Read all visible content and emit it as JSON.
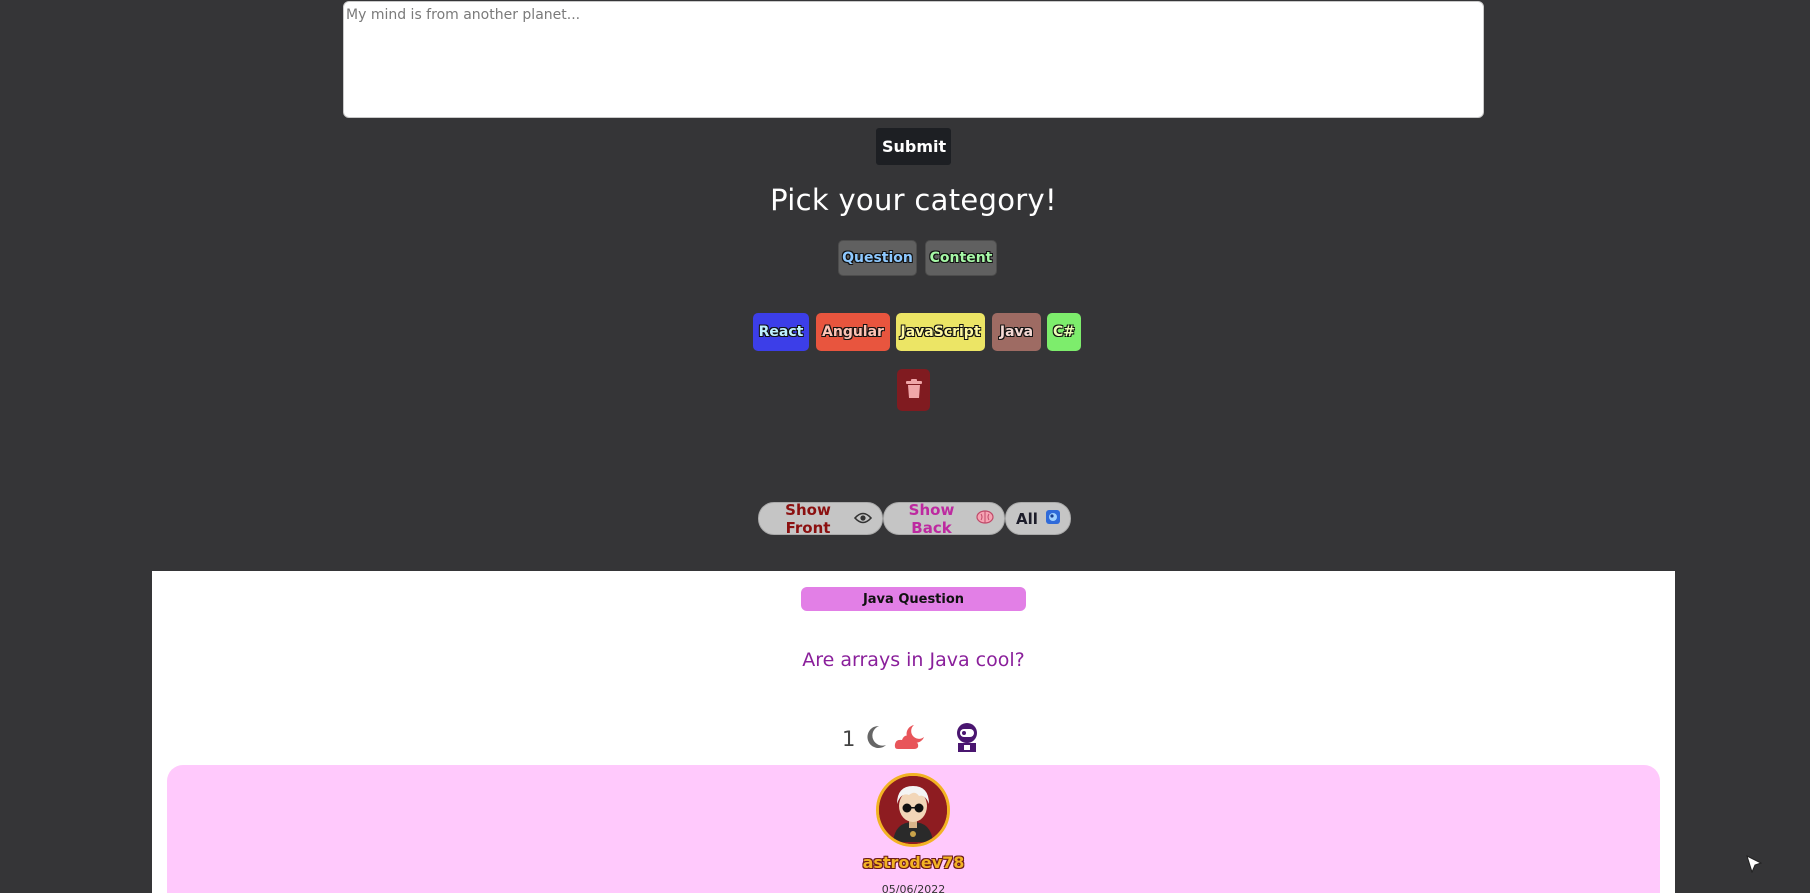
{
  "composer": {
    "placeholder": "My mind is from another planet...",
    "submit_label": "Submit"
  },
  "category_picker": {
    "title": "Pick your category!",
    "categories": [
      "Question",
      "Content"
    ],
    "tags": [
      "React",
      "Angular",
      "JavaScript",
      "Java",
      "C#"
    ],
    "clear_icon": "trash-icon"
  },
  "filters": {
    "show_front_label": "Show Front",
    "show_front_icon": "eye-icon",
    "show_back_label": "Show Back",
    "show_back_icon": "brain-icon",
    "all_label": "All",
    "all_icon": "gem-icon"
  },
  "post": {
    "badge": "Java Question",
    "question": "Are arrays in Java cool?",
    "vote_count": "1",
    "vote_icon": "moon-icon",
    "react_icon": "cloud-moon-icon",
    "author_icon": "astronaut-icon",
    "answer": {
      "username": "astrodev78",
      "date": "05/06/2022"
    }
  },
  "colors": {
    "background": "#353537",
    "react": "#3c3ee8",
    "angular": "#e8553e",
    "javascript": "#ece565",
    "java": "#9e6b63",
    "csharp": "#7ded6c",
    "badge": "#e27fe6",
    "answer_panel": "#ffc9fc",
    "question_text": "#8a1f9b"
  }
}
